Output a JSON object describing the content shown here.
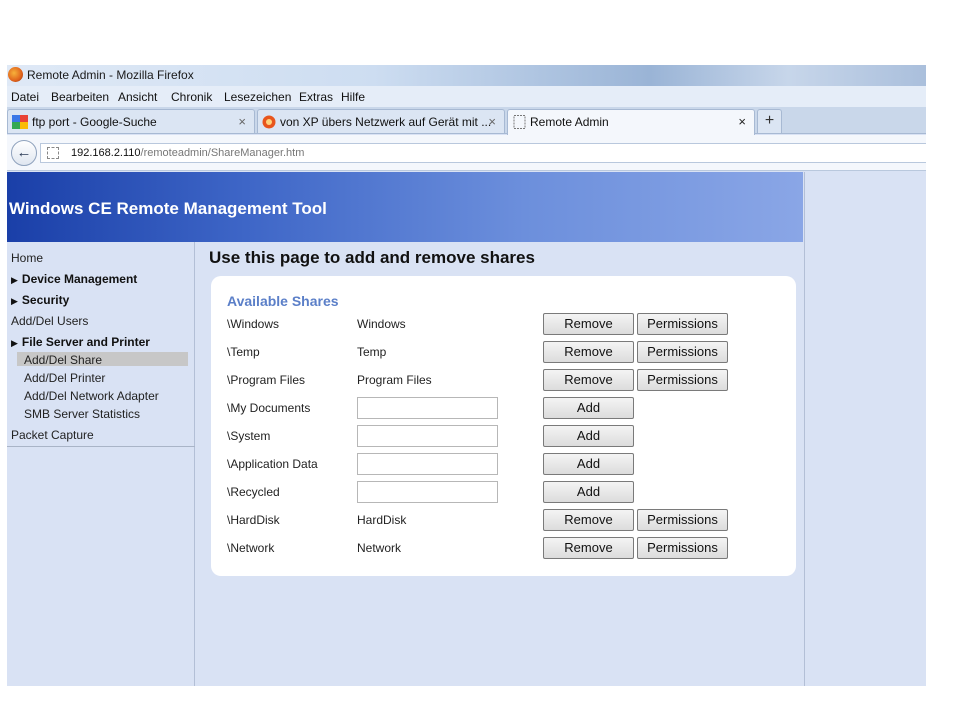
{
  "window": {
    "title": "Remote Admin - Mozilla Firefox"
  },
  "menu": [
    {
      "label": "Datei"
    },
    {
      "label": "Bearbeiten"
    },
    {
      "label": "Ansicht"
    },
    {
      "label": "Chronik"
    },
    {
      "label": "Lesezeichen"
    },
    {
      "label": "Extras"
    },
    {
      "label": "Hilfe"
    }
  ],
  "tabs": [
    {
      "label": "ftp port - Google-Suche",
      "icon": "google-icon"
    },
    {
      "label": "von XP übers Netzwerk auf Gerät mit ...",
      "icon": "forum-icon"
    },
    {
      "label": "Remote Admin",
      "icon": "page-icon"
    }
  ],
  "tab_close_glyph": "×",
  "new_tab_glyph": "+",
  "nav": {
    "url_host": "192.168.2.110",
    "url_path": "/remoteadmin/ShareManager.htm"
  },
  "page": {
    "header": "Windows CE Remote Management Tool",
    "heading": "Use this page to add and remove shares",
    "card_title": "Available Shares"
  },
  "sidebar": [
    {
      "label": "Home"
    },
    {
      "label": "Device Management"
    },
    {
      "label": "Security"
    },
    {
      "label": "Add/Del Users"
    },
    {
      "label": "File Server and Printer"
    },
    {
      "label": "Add/Del Share"
    },
    {
      "label": "Add/Del Printer"
    },
    {
      "label": "Add/Del Network Adapter"
    },
    {
      "label": "SMB Server Statistics"
    },
    {
      "label": "Packet Capture"
    }
  ],
  "shares": [
    {
      "path": "\\Windows",
      "name": "Windows",
      "shared": true
    },
    {
      "path": "\\Temp",
      "name": "Temp",
      "shared": true
    },
    {
      "path": "\\Program Files",
      "name": "Program Files",
      "shared": true
    },
    {
      "path": "\\My Documents",
      "name": "",
      "shared": false
    },
    {
      "path": "\\System",
      "name": "",
      "shared": false
    },
    {
      "path": "\\Application Data",
      "name": "",
      "shared": false
    },
    {
      "path": "\\Recycled",
      "name": "",
      "shared": false
    },
    {
      "path": "\\HardDisk",
      "name": "HardDisk",
      "shared": true
    },
    {
      "path": "\\Network",
      "name": "Network",
      "shared": true
    }
  ],
  "buttons": {
    "remove": "Remove",
    "permissions": "Permissions",
    "add": "Add"
  }
}
